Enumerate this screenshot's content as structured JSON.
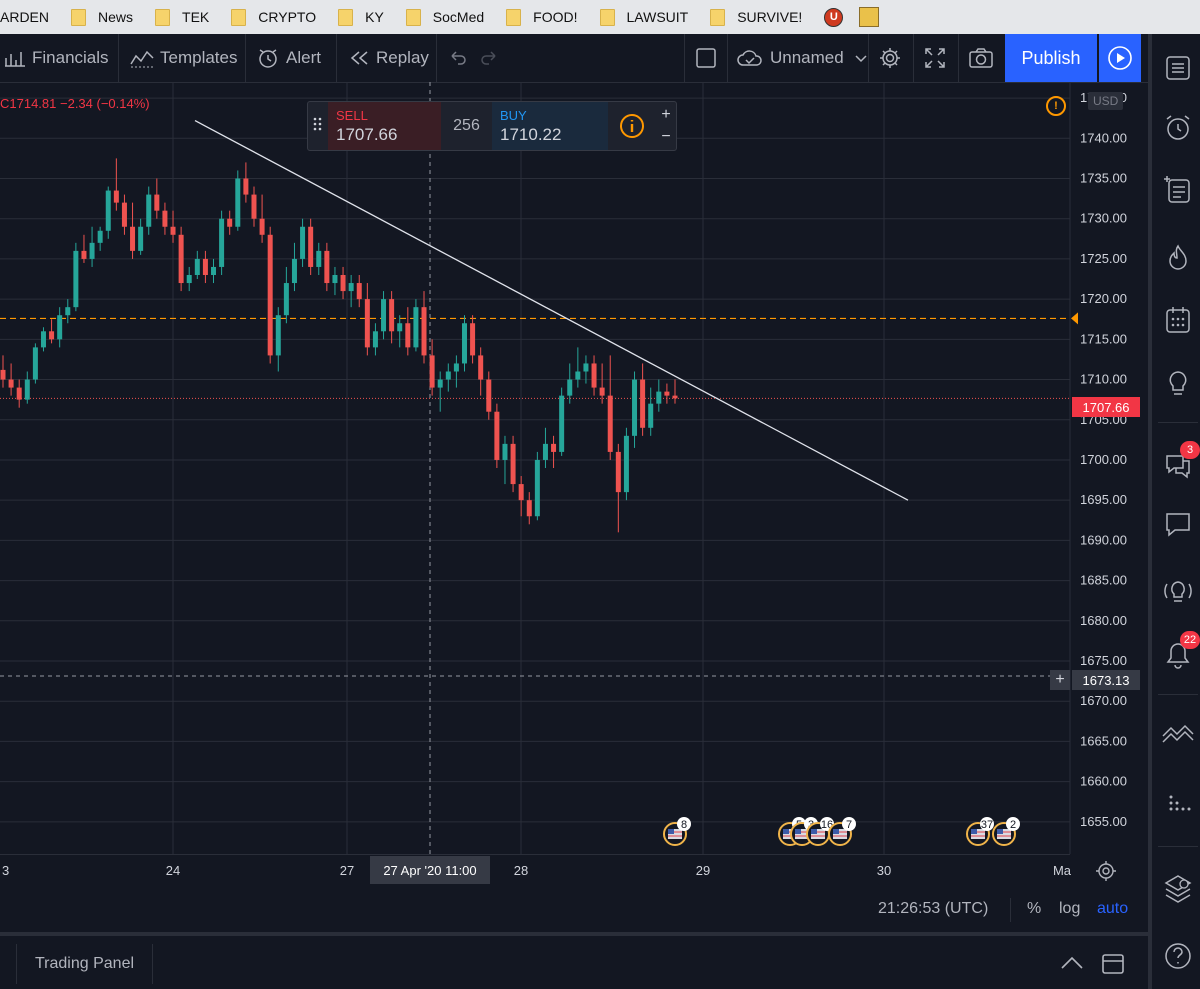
{
  "bookmarks": [
    {
      "label": "ARDEN",
      "icon": "folder-icon"
    },
    {
      "label": "News",
      "icon": "folder-icon"
    },
    {
      "label": "TEK",
      "icon": "folder-icon"
    },
    {
      "label": "CRYPTO",
      "icon": "folder-icon"
    },
    {
      "label": "KY",
      "icon": "folder-icon"
    },
    {
      "label": "SocMed",
      "icon": "folder-icon"
    },
    {
      "label": "FOOD!",
      "icon": "folder-icon"
    },
    {
      "label": "LAWSUIT",
      "icon": "folder-icon"
    },
    {
      "label": "SURVIVE!",
      "icon": "folder-icon"
    }
  ],
  "toolbar": {
    "financials": "Financials",
    "templates": "Templates",
    "alert": "Alert",
    "replay": "Replay",
    "layout_name": "Unnamed",
    "publish": "Publish"
  },
  "legend": {
    "ohlc": "C1714.81  −2.34 (−0.14%)"
  },
  "trade": {
    "sell_label": "SELL",
    "sell_price": "1707.66",
    "spread": "256",
    "buy_label": "BUY",
    "buy_price": "1710.22"
  },
  "price_axis": {
    "currency": "USD",
    "last_price": "1707.66",
    "crosshair_price": "1673.13",
    "ticks": [
      "1745.00",
      "1740.00",
      "1735.00",
      "1730.00",
      "1725.00",
      "1720.00",
      "1715.00",
      "1710.00",
      "1705.00",
      "1700.00",
      "1695.00",
      "1690.00",
      "1685.00",
      "1680.00",
      "1675.00",
      "1670.00",
      "1665.00",
      "1660.00",
      "1655.00"
    ]
  },
  "time_axis": {
    "labels": [
      "3",
      "24",
      "27",
      "28",
      "29",
      "30",
      "Ma"
    ],
    "crosshair_date": "27 Apr '20   11:00"
  },
  "events": [
    {
      "count": "8"
    },
    {
      "count": "5"
    },
    {
      "count": "3"
    },
    {
      "count": "16"
    },
    {
      "count": "7"
    },
    {
      "count": "37"
    },
    {
      "count": "2"
    }
  ],
  "status": {
    "clock": "21:26:53 (UTC)",
    "percent": "%",
    "log": "log",
    "auto": "auto"
  },
  "bottom": {
    "trading_panel": "Trading Panel"
  },
  "right_bar": {
    "chat_badge": "3",
    "notification_badge": "22"
  },
  "colors": {
    "up": "#26a69a",
    "down": "#ef5350",
    "accent": "#2962ff",
    "alert_line": "#ff9800"
  },
  "chart_data": {
    "type": "candlestick",
    "title": "",
    "xlabel": "",
    "ylabel": "",
    "ylim": [
      1651,
      1747
    ],
    "x_ticks": [
      "3",
      "24",
      "27",
      "28",
      "29",
      "30",
      "Ma"
    ],
    "alert_level": 1717.6,
    "last_price": 1707.66,
    "crosshair_price": 1673.13,
    "trend_line": {
      "from": {
        "time": "23 Apr 20:00",
        "price": 1742.2
      },
      "to": {
        "time": "30 Apr 01:00",
        "price": 1695.0
      }
    },
    "candles_ohlc": [
      [
        1711.2,
        1713.0,
        1709.0,
        1710.0
      ],
      [
        1710.0,
        1712.0,
        1708.0,
        1709.0
      ],
      [
        1709.0,
        1710.0,
        1706.5,
        1707.5
      ],
      [
        1707.5,
        1711.0,
        1707.0,
        1710.0
      ],
      [
        1710.0,
        1714.5,
        1709.5,
        1714.0
      ],
      [
        1714.0,
        1716.5,
        1713.5,
        1716.0
      ],
      [
        1716.0,
        1717.5,
        1714.5,
        1715.0
      ],
      [
        1715.0,
        1719.0,
        1714.0,
        1718.0
      ],
      [
        1718.0,
        1720.0,
        1717.0,
        1719.0
      ],
      [
        1719.0,
        1727.0,
        1718.5,
        1726.0
      ],
      [
        1726.0,
        1728.0,
        1724.5,
        1725.0
      ],
      [
        1725.0,
        1729.0,
        1724.0,
        1727.0
      ],
      [
        1727.0,
        1729.0,
        1726.0,
        1728.5
      ],
      [
        1728.5,
        1734.0,
        1727.5,
        1733.5
      ],
      [
        1733.5,
        1737.5,
        1731.0,
        1732.0
      ],
      [
        1732.0,
        1733.0,
        1728.0,
        1729.0
      ],
      [
        1729.0,
        1732.0,
        1725.0,
        1726.0
      ],
      [
        1726.0,
        1730.0,
        1725.5,
        1729.0
      ],
      [
        1729.0,
        1734.0,
        1728.0,
        1733.0
      ],
      [
        1733.0,
        1735.0,
        1730.0,
        1731.0
      ],
      [
        1731.0,
        1732.0,
        1728.0,
        1729.0
      ],
      [
        1729.0,
        1731.0,
        1727.0,
        1728.0
      ],
      [
        1728.0,
        1729.0,
        1721.0,
        1722.0
      ],
      [
        1722.0,
        1724.0,
        1721.0,
        1723.0
      ],
      [
        1723.0,
        1726.0,
        1722.5,
        1725.0
      ],
      [
        1725.0,
        1726.0,
        1722.0,
        1723.0
      ],
      [
        1723.0,
        1725.0,
        1722.0,
        1724.0
      ],
      [
        1724.0,
        1731.0,
        1723.0,
        1730.0
      ],
      [
        1730.0,
        1731.0,
        1728.0,
        1729.0
      ],
      [
        1729.0,
        1736.0,
        1728.5,
        1735.0
      ],
      [
        1735.0,
        1737.0,
        1732.0,
        1733.0
      ],
      [
        1733.0,
        1734.0,
        1729.0,
        1730.0
      ],
      [
        1730.0,
        1733.0,
        1727.0,
        1728.0
      ],
      [
        1728.0,
        1729.0,
        1712.0,
        1713.0
      ],
      [
        1713.0,
        1719.0,
        1711.0,
        1718.0
      ],
      [
        1718.0,
        1724.0,
        1717.0,
        1722.0
      ],
      [
        1722.0,
        1727.0,
        1721.0,
        1725.0
      ],
      [
        1725.0,
        1730.0,
        1724.0,
        1729.0
      ],
      [
        1729.0,
        1730.0,
        1723.0,
        1724.0
      ],
      [
        1724.0,
        1727.0,
        1723.0,
        1726.0
      ],
      [
        1726.0,
        1727.0,
        1721.0,
        1722.0
      ],
      [
        1722.0,
        1724.0,
        1720.5,
        1723.0
      ],
      [
        1723.0,
        1724.0,
        1720.0,
        1721.0
      ],
      [
        1721.0,
        1723.0,
        1719.0,
        1722.0
      ],
      [
        1722.0,
        1723.0,
        1719.0,
        1720.0
      ],
      [
        1720.0,
        1722.0,
        1713.0,
        1714.0
      ],
      [
        1714.0,
        1717.0,
        1713.0,
        1716.0
      ],
      [
        1716.0,
        1721.0,
        1715.0,
        1720.0
      ],
      [
        1720.0,
        1721.0,
        1714.5,
        1716.0
      ],
      [
        1716.0,
        1718.0,
        1714.0,
        1717.0
      ],
      [
        1717.0,
        1719.0,
        1713.0,
        1714.0
      ],
      [
        1714.0,
        1720.0,
        1713.5,
        1719.0
      ],
      [
        1719.0,
        1721.0,
        1712.0,
        1713.0
      ],
      [
        1713.0,
        1715.0,
        1708.0,
        1709.0
      ],
      [
        1709.0,
        1711.0,
        1706.0,
        1710.0
      ],
      [
        1710.0,
        1712.0,
        1708.5,
        1711.0
      ],
      [
        1711.0,
        1713.0,
        1709.0,
        1712.0
      ],
      [
        1712.0,
        1718.0,
        1711.0,
        1717.0
      ],
      [
        1717.0,
        1718.0,
        1712.0,
        1713.0
      ],
      [
        1713.0,
        1714.0,
        1708.0,
        1710.0
      ],
      [
        1710.0,
        1711.0,
        1705.0,
        1706.0
      ],
      [
        1706.0,
        1707.0,
        1699.0,
        1700.0
      ],
      [
        1700.0,
        1703.0,
        1697.0,
        1702.0
      ],
      [
        1702.0,
        1703.0,
        1696.0,
        1697.0
      ],
      [
        1697.0,
        1698.0,
        1693.0,
        1695.0
      ],
      [
        1695.0,
        1696.0,
        1692.0,
        1693.0
      ],
      [
        1693.0,
        1701.0,
        1692.5,
        1700.0
      ],
      [
        1700.0,
        1704.0,
        1699.0,
        1702.0
      ],
      [
        1702.0,
        1703.0,
        1699.0,
        1701.0
      ],
      [
        1701.0,
        1709.0,
        1700.5,
        1708.0
      ],
      [
        1708.0,
        1712.0,
        1707.0,
        1710.0
      ],
      [
        1710.0,
        1714.0,
        1709.0,
        1711.0
      ],
      [
        1711.0,
        1713.0,
        1709.5,
        1712.0
      ],
      [
        1712.0,
        1713.0,
        1708.0,
        1709.0
      ],
      [
        1709.0,
        1712.0,
        1707.0,
        1708.0
      ],
      [
        1708.0,
        1713.0,
        1700.0,
        1701.0
      ],
      [
        1701.0,
        1702.0,
        1691.0,
        1696.0
      ],
      [
        1696.0,
        1704.0,
        1695.0,
        1703.0
      ],
      [
        1703.0,
        1711.0,
        1701.5,
        1710.0
      ],
      [
        1710.0,
        1712.0,
        1703.0,
        1704.0
      ],
      [
        1704.0,
        1709.0,
        1703.0,
        1707.0
      ],
      [
        1707.0,
        1710.0,
        1706.0,
        1708.5
      ],
      [
        1708.5,
        1709.5,
        1707.0,
        1708.0
      ],
      [
        1708.0,
        1710.0,
        1707.0,
        1707.66
      ]
    ]
  }
}
